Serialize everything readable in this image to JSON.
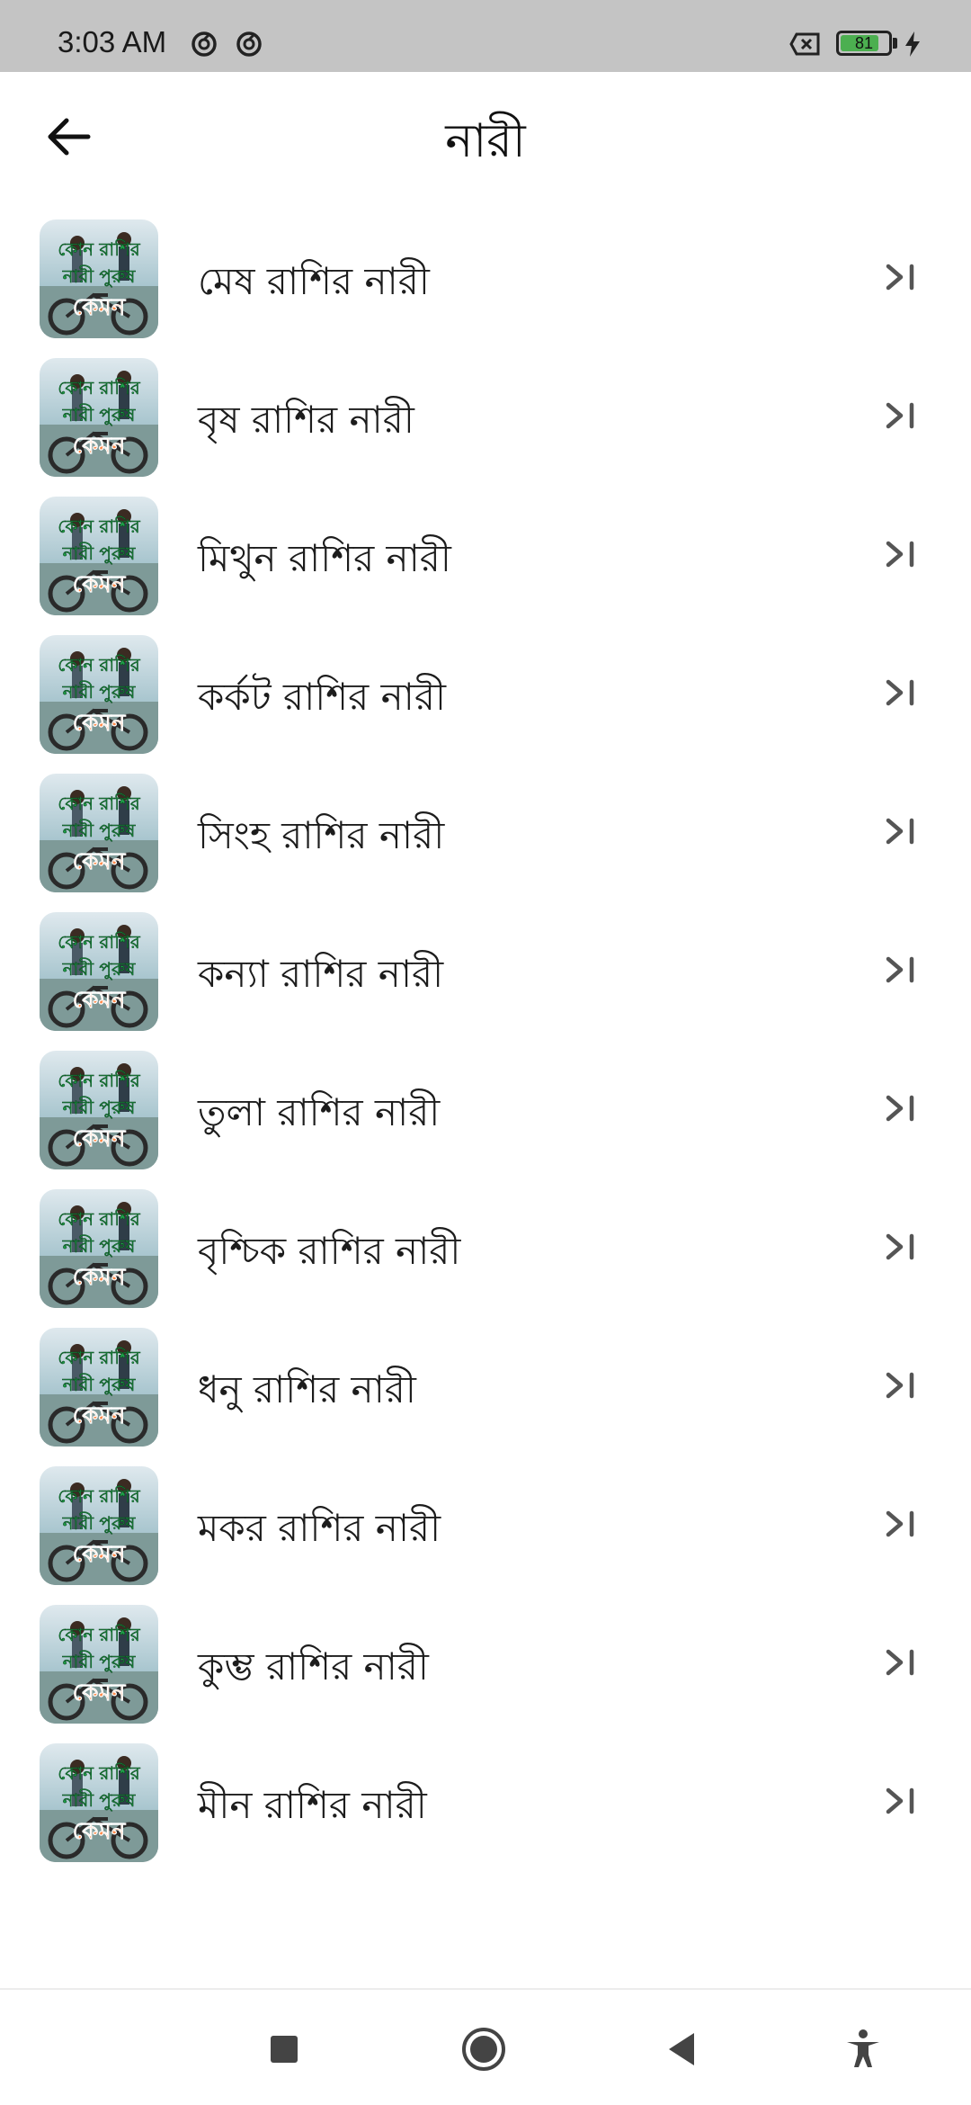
{
  "status_bar": {
    "time": "3:03 AM",
    "battery_level": "81",
    "battery_fraction": 0.81
  },
  "header": {
    "title": "নারী",
    "back_icon": "arrow-left-icon"
  },
  "thumbnail": {
    "caption_line1": "কোন রাশির",
    "caption_line2": "নারী পুরুষ",
    "caption_line3": "কেমন"
  },
  "list": {
    "items": [
      {
        "label": "মেষ রাশির নারী"
      },
      {
        "label": "বৃষ রাশির নারী"
      },
      {
        "label": "মিথুন রাশির নারী"
      },
      {
        "label": "কর্কট রাশির নারী"
      },
      {
        "label": "সিংহ রাশির নারী"
      },
      {
        "label": "কন্যা রাশির নারী"
      },
      {
        "label": "তুলা রাশির নারী"
      },
      {
        "label": "বৃশ্চিক রাশির নারী"
      },
      {
        "label": "ধনু রাশির নারী"
      },
      {
        "label": "মকর রাশির নারী"
      },
      {
        "label": "কুম্ভ রাশির নারী"
      },
      {
        "label": "মীন রাশির নারী"
      }
    ]
  },
  "nav_bar": {
    "icons": [
      "recents-square-icon",
      "home-circle-icon",
      "back-triangle-icon",
      "accessibility-icon"
    ]
  },
  "colors": {
    "status_bar_bg": "#c4c4c4",
    "battery_green": "#4caf50",
    "chevron_gray": "#555555",
    "text_primary": "#1c1c1c"
  }
}
